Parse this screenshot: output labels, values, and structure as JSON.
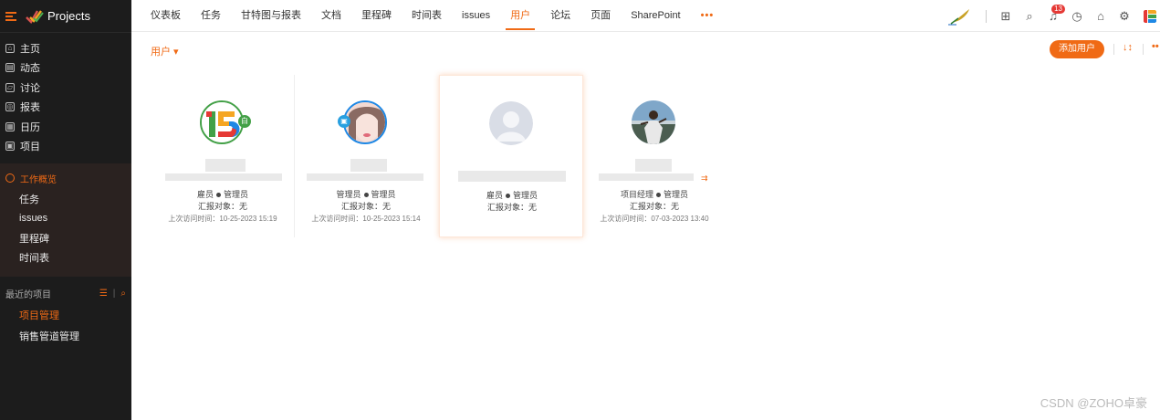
{
  "app": {
    "name": "Projects"
  },
  "sidebar": {
    "main": [
      {
        "label": "主页",
        "glyph": "⌂"
      },
      {
        "label": "动态",
        "glyph": "▤"
      },
      {
        "label": "讨论",
        "glyph": "▱"
      },
      {
        "label": "报表",
        "glyph": "◎"
      },
      {
        "label": "日历",
        "glyph": "▦"
      },
      {
        "label": "项目",
        "glyph": "▣"
      }
    ],
    "overview_title": "工作概览",
    "overview": [
      "任务",
      "issues",
      "里程碑",
      "时间表"
    ],
    "recent_title": "最近的项目",
    "recent": [
      "项目管理",
      "销售管道管理"
    ]
  },
  "tabs": [
    "仪表板",
    "任务",
    "甘特图与报表",
    "文档",
    "里程碑",
    "时间表",
    "issues",
    "用户",
    "论坛",
    "页面",
    "SharePoint",
    "•••"
  ],
  "active_tab": "用户",
  "notifications": {
    "count": "13"
  },
  "toolbar": {
    "users_dropdown": "用户 ▾",
    "add_user": "添加用户",
    "sort": "↓↕",
    "more": "••"
  },
  "users": [
    {
      "role": "雇员",
      "profile": "管理员",
      "report_label": "汇报对象：",
      "report_to": "无",
      "last_visit": "上次访问时间：10-25-2023 15:19",
      "avatar": "logo-15"
    },
    {
      "role": "管理员",
      "profile": "管理员",
      "report_label": "汇报对象：",
      "report_to": "无",
      "last_visit": "上次访问时间：10-25-2023 15:14",
      "avatar": "photo-girl"
    },
    {
      "role": "雇员",
      "profile": "管理员",
      "report_label": "汇报对象：",
      "report_to": "无",
      "last_visit": "",
      "avatar": "placeholder"
    },
    {
      "role": "项目经理",
      "profile": "管理员",
      "report_label": "汇报对象：",
      "report_to": "无",
      "last_visit": "上次访问时间：07-03-2023 13:40",
      "avatar": "photo-man"
    }
  ],
  "watermark": "CSDN @ZOHO卓豪",
  "colors": {
    "accent": "#f06a15",
    "sidebar_bg": "#1c1c1c"
  }
}
